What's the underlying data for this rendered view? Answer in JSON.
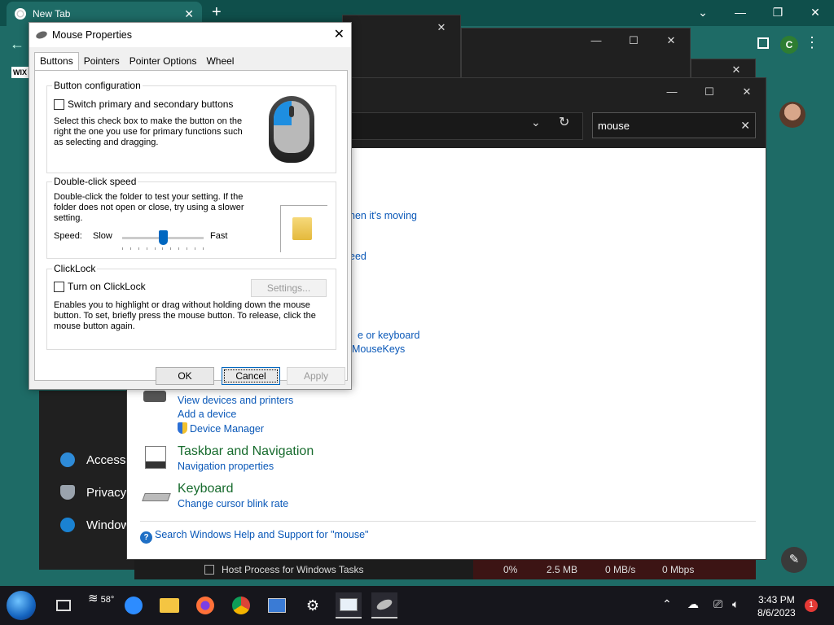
{
  "chrome": {
    "tab_title": "New Tab",
    "tab_close": "✕",
    "new_tab": "+",
    "win_min": "⌄",
    "win_restore_a": "—",
    "win_restore_b": "❐",
    "win_close": "✕",
    "profile_letter": "C",
    "bookmark_wix": "WIX"
  },
  "dark_windows": {
    "btn_min": "—",
    "btn_max": "☐",
    "btn_close": "✕"
  },
  "settings_items": [
    {
      "label": "Accessi",
      "color": "#2e8bd8"
    },
    {
      "label": "Privacy",
      "color": "#9aa3ad"
    },
    {
      "label": "Window",
      "color": "#1a82d2"
    }
  ],
  "control_panel": {
    "search_value": "mouse",
    "search_clear": "✕",
    "links": {
      "moving": "hen it's moving",
      "speed": "eed",
      "keyboard": "e or keyboard",
      "mousekeys": "MouseKeys",
      "view_devices": "View devices and printers",
      "add_device": "Add a device",
      "device_manager": "Device Manager",
      "nav_props": "Navigation properties",
      "cursor_blink": "Change cursor blink rate",
      "help_search": "Search Windows Help and Support for \"mouse\""
    },
    "headings": {
      "taskbar": "Taskbar and Navigation",
      "keyboard": "Keyboard"
    }
  },
  "task_manager": {
    "process_name": "Host Process for Windows Tasks",
    "cpu": "0%",
    "memory": "2.5 MB",
    "disk": "0 MB/s",
    "network": "0 Mbps"
  },
  "dialog": {
    "title": "Mouse Properties",
    "close": "✕",
    "tabs": [
      "Buttons",
      "Pointers",
      "Pointer Options",
      "Wheel"
    ],
    "button_config": {
      "label": "Button configuration",
      "checkbox": "Switch primary and secondary buttons",
      "description": "Select this check box to make the button on the right the one you use for primary functions such as selecting and dragging."
    },
    "double_click": {
      "label": "Double-click speed",
      "description": "Double-click the folder to test your setting. If the folder does not open or close, try using a slower setting.",
      "speed_label": "Speed:",
      "slow": "Slow",
      "fast": "Fast"
    },
    "clicklock": {
      "label": "ClickLock",
      "checkbox": "Turn on ClickLock",
      "settings_button": "Settings...",
      "description": "Enables you to highlight or drag without holding down the mouse button. To set, briefly press the mouse button. To release, click the mouse button again."
    },
    "buttons": {
      "ok": "OK",
      "cancel": "Cancel",
      "apply": "Apply"
    }
  },
  "taskbar": {
    "weather_temp": "58°",
    "time": "3:43 PM",
    "date": "8/6/2023",
    "notification_count": "1"
  }
}
